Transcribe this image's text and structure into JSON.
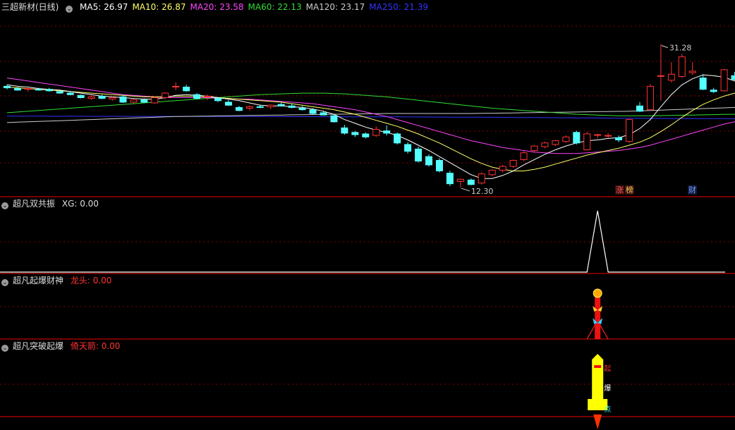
{
  "main": {
    "title": "三超新材(日线)",
    "ma": [
      {
        "label": "MA5: 26.97",
        "color": "#ffffff"
      },
      {
        "label": "MA10: 26.87",
        "color": "#ffff66"
      },
      {
        "label": "MA20: 23.58",
        "color": "#ff44ff"
      },
      {
        "label": "MA60: 22.13",
        "color": "#33dd33"
      },
      {
        "label": "MA120: 23.17",
        "color": "#cccccc"
      },
      {
        "label": "MA250: 21.39",
        "color": "#3333ff"
      }
    ],
    "high_label": "31.28",
    "low_label": "12.30",
    "tag_zhang": "涨",
    "tag_bang": "榜",
    "tag_cai": "财"
  },
  "panel1": {
    "title": "超凡双共振",
    "field": "XG: 0.00"
  },
  "panel2": {
    "title": "超凡起爆财神",
    "field_name": "龙头",
    "field_value": ": 0.00"
  },
  "panel3": {
    "title": "超凡突破起爆",
    "field_name": "倚天箭",
    "field_value": ": 0.00",
    "rocket_chars": [
      "起",
      "爆",
      "点"
    ]
  },
  "colors": {
    "up": "#ff3232",
    "down": "#54ffff",
    "grid": "#8b0000",
    "axis": "#c00000"
  },
  "chart_data": {
    "type": "candlestick",
    "ylim": [
      11,
      36
    ],
    "candles": [
      [
        25.7,
        25.9,
        25.3,
        25.5
      ],
      [
        25.4,
        25.6,
        25.1,
        25.2
      ],
      [
        25.3,
        25.5,
        25.0,
        25.4
      ],
      [
        25.3,
        25.5,
        25.1,
        25.2
      ],
      [
        25.3,
        25.5,
        25.0,
        25.1
      ],
      [
        25.0,
        25.2,
        24.7,
        24.8
      ],
      [
        24.8,
        25.1,
        24.5,
        24.6
      ],
      [
        24.5,
        24.6,
        24.1,
        24.2
      ],
      [
        24.1,
        24.5,
        23.9,
        24.3
      ],
      [
        24.4,
        24.6,
        24.0,
        24.1
      ],
      [
        24.0,
        24.3,
        23.8,
        24.2
      ],
      [
        24.3,
        24.6,
        23.5,
        23.6
      ],
      [
        23.6,
        24.0,
        23.4,
        23.9
      ],
      [
        23.9,
        24.1,
        23.5,
        23.6
      ],
      [
        23.5,
        24.3,
        23.4,
        24.2
      ],
      [
        24.2,
        24.9,
        24.0,
        24.8
      ],
      [
        25.6,
        26.2,
        25.2,
        25.7
      ],
      [
        25.6,
        25.9,
        25.0,
        25.1
      ],
      [
        24.6,
        24.8,
        24.0,
        24.1
      ],
      [
        24.3,
        24.6,
        23.9,
        24.4
      ],
      [
        24.1,
        24.3,
        23.6,
        23.8
      ],
      [
        23.6,
        23.9,
        23.1,
        23.2
      ],
      [
        22.9,
        23.1,
        22.4,
        22.5
      ],
      [
        22.8,
        23.2,
        22.5,
        23.0
      ],
      [
        23.0,
        23.3,
        22.8,
        22.9
      ],
      [
        23.0,
        23.3,
        22.7,
        23.2
      ],
      [
        23.3,
        23.6,
        23.0,
        23.1
      ],
      [
        23.1,
        23.4,
        22.8,
        22.9
      ],
      [
        22.8,
        23.1,
        22.5,
        22.6
      ],
      [
        22.6,
        22.8,
        22.0,
        22.1
      ],
      [
        22.2,
        22.5,
        21.9,
        21.9
      ],
      [
        21.8,
        22.0,
        20.9,
        21.0
      ],
      [
        20.2,
        20.6,
        19.3,
        19.5
      ],
      [
        19.6,
        19.8,
        19.0,
        19.3
      ],
      [
        19.4,
        19.6,
        18.8,
        19.0
      ],
      [
        19.2,
        20.4,
        19.0,
        20.0
      ],
      [
        19.8,
        20.5,
        19.2,
        19.5
      ],
      [
        19.4,
        19.6,
        18.0,
        18.2
      ],
      [
        18.0,
        18.3,
        16.8,
        17.1
      ],
      [
        17.4,
        17.7,
        15.6,
        15.8
      ],
      [
        16.4,
        16.7,
        15.1,
        15.3
      ],
      [
        15.9,
        16.2,
        14.3,
        14.5
      ],
      [
        14.2,
        14.5,
        12.5,
        12.8
      ],
      [
        13.1,
        13.5,
        12.3,
        13.4
      ],
      [
        13.3,
        13.5,
        12.6,
        12.7
      ],
      [
        12.9,
        14.3,
        12.7,
        14.1
      ],
      [
        14.0,
        14.7,
        13.8,
        14.6
      ],
      [
        14.6,
        15.3,
        14.3,
        15.1
      ],
      [
        15.1,
        16.0,
        14.9,
        15.9
      ],
      [
        16.0,
        17.1,
        15.8,
        16.9
      ],
      [
        17.2,
        17.9,
        16.9,
        17.8
      ],
      [
        17.7,
        18.4,
        17.5,
        18.2
      ],
      [
        18.0,
        18.6,
        17.8,
        18.5
      ],
      [
        18.4,
        19.2,
        18.2,
        19.0
      ],
      [
        19.6,
        19.8,
        18.0,
        18.2
      ],
      [
        17.3,
        19.7,
        17.2,
        19.4
      ],
      [
        19.3,
        19.4,
        18.8,
        19.3
      ],
      [
        19.1,
        19.5,
        18.9,
        19.2
      ],
      [
        18.9,
        19.2,
        18.3,
        18.6
      ],
      [
        18.4,
        21.4,
        18.2,
        21.3
      ],
      [
        23.1,
        23.6,
        22.3,
        22.4
      ],
      [
        22.6,
        26.0,
        22.5,
        25.7
      ],
      [
        27.1,
        31.3,
        23.8,
        27.1
      ],
      [
        26.5,
        28.9,
        26.2,
        27.3
      ],
      [
        27.0,
        30.0,
        26.8,
        29.6
      ],
      [
        27.5,
        28.9,
        27.2,
        27.7
      ],
      [
        26.8,
        27.3,
        25.2,
        25.3
      ],
      [
        25.2,
        25.5,
        24.8,
        25.0
      ],
      [
        25.1,
        28.0,
        25.0,
        27.9
      ],
      [
        27.1,
        27.6,
        26.5,
        26.6
      ],
      [
        27.1,
        28.6,
        26.9,
        28.5
      ],
      [
        28.5,
        28.9,
        27.3,
        27.5
      ],
      [
        28.2,
        28.5,
        27.3,
        27.4
      ],
      [
        27.3,
        27.6,
        25.6,
        25.7
      ]
    ],
    "ma5": [
      25.9,
      25.7,
      25.6,
      25.4,
      25.3,
      25.2,
      25.0,
      24.8,
      24.6,
      24.4,
      24.3,
      24.2,
      24.1,
      24.0,
      24.0,
      24.2,
      24.5,
      24.6,
      24.5,
      24.4,
      24.2,
      24.0,
      23.8,
      23.5,
      23.2,
      23.1,
      23.1,
      23.0,
      22.9,
      22.7,
      22.4,
      22.0,
      21.3,
      20.8,
      20.3,
      19.9,
      19.6,
      19.2,
      18.6,
      17.9,
      17.2,
      16.4,
      15.6,
      14.8,
      14.0,
      13.5,
      13.5,
      13.9,
      14.5,
      15.3,
      16.0,
      16.7,
      17.3,
      17.8,
      18.2,
      18.5,
      18.6,
      18.8,
      18.9,
      19.3,
      20.1,
      21.3,
      23.0,
      24.6,
      25.9,
      26.7,
      27.2,
      27.1,
      26.9,
      26.4,
      26.6,
      27.0,
      27.1,
      27.0
    ],
    "ma10": [
      25.6,
      25.5,
      25.4,
      25.3,
      25.2,
      25.1,
      25.0,
      24.9,
      24.8,
      24.7,
      24.6,
      24.5,
      24.4,
      24.3,
      24.3,
      24.3,
      24.4,
      24.4,
      24.4,
      24.3,
      24.2,
      24.1,
      24.0,
      23.9,
      23.8,
      23.7,
      23.6,
      23.4,
      23.2,
      23.0,
      22.8,
      22.6,
      22.3,
      22.0,
      21.6,
      21.2,
      20.8,
      20.4,
      19.9,
      19.4,
      18.8,
      18.2,
      17.5,
      16.8,
      16.1,
      15.5,
      15.0,
      14.7,
      14.5,
      14.5,
      14.7,
      15.0,
      15.4,
      15.8,
      16.2,
      16.6,
      16.9,
      17.2,
      17.5,
      17.9,
      18.3,
      18.9,
      19.7,
      20.6,
      21.6,
      22.5,
      23.3,
      23.9,
      24.4,
      24.8,
      25.4,
      26.0,
      26.4,
      26.9
    ],
    "ma20": [
      26.8,
      26.6,
      26.4,
      26.2,
      26.0,
      25.8,
      25.6,
      25.4,
      25.2,
      25.0,
      24.8,
      24.6,
      24.5,
      24.4,
      24.3,
      24.2,
      24.2,
      24.2,
      24.2,
      24.2,
      24.1,
      24.1,
      24.0,
      24.0,
      23.9,
      23.8,
      23.7,
      23.6,
      23.5,
      23.4,
      23.2,
      23.0,
      22.8,
      22.6,
      22.3,
      22.0,
      21.7,
      21.3,
      20.9,
      20.5,
      20.1,
      19.7,
      19.3,
      18.9,
      18.5,
      18.2,
      17.9,
      17.6,
      17.4,
      17.2,
      17.0,
      16.9,
      16.8,
      16.8,
      16.8,
      16.9,
      17.0,
      17.1,
      17.2,
      17.4,
      17.6,
      17.9,
      18.3,
      18.7,
      19.1,
      19.5,
      19.9,
      20.3,
      20.7,
      21.0,
      21.5,
      22.0,
      22.5,
      23.0
    ],
    "ma60": [
      22.2,
      22.3,
      22.4,
      22.5,
      22.6,
      22.7,
      22.8,
      22.9,
      23.0,
      23.1,
      23.2,
      23.3,
      23.4,
      23.5,
      23.6,
      23.7,
      23.8,
      23.9,
      24.0,
      24.1,
      24.2,
      24.3,
      24.4,
      24.5,
      24.6,
      24.65,
      24.7,
      24.75,
      24.8,
      24.8,
      24.8,
      24.75,
      24.7,
      24.6,
      24.5,
      24.4,
      24.3,
      24.15,
      24.0,
      23.85,
      23.7,
      23.55,
      23.4,
      23.25,
      23.1,
      22.95,
      22.8,
      22.7,
      22.6,
      22.5,
      22.4,
      22.3,
      22.2,
      22.1,
      22.0,
      21.95,
      21.9,
      21.85,
      21.8,
      21.8,
      21.8,
      21.8,
      21.82,
      21.85,
      21.88,
      21.9,
      21.92,
      21.95,
      21.98,
      22.0,
      22.03,
      22.06,
      22.1,
      22.13
    ],
    "ma120": [
      20.9,
      20.95,
      21.0,
      21.05,
      21.1,
      21.15,
      21.2,
      21.25,
      21.3,
      21.35,
      21.4,
      21.45,
      21.5,
      21.55,
      21.6,
      21.65,
      21.7,
      21.72,
      21.74,
      21.76,
      21.78,
      21.8,
      21.82,
      21.84,
      21.86,
      21.88,
      21.9,
      21.92,
      21.94,
      21.96,
      21.98,
      22.0,
      22.02,
      22.04,
      22.06,
      22.08,
      22.1,
      22.1,
      22.1,
      22.1,
      22.1,
      22.1,
      22.1,
      22.1,
      22.1,
      22.12,
      22.14,
      22.16,
      22.18,
      22.2,
      22.22,
      22.24,
      22.26,
      22.28,
      22.3,
      22.32,
      22.34,
      22.36,
      22.38,
      22.4,
      22.45,
      22.5,
      22.55,
      22.6,
      22.65,
      22.7,
      22.75,
      22.8,
      22.85,
      22.9,
      22.95,
      23.0,
      23.08,
      23.17
    ],
    "ma250": [
      21.75,
      21.75,
      21.75,
      21.75,
      21.74,
      21.74,
      21.74,
      21.74,
      21.73,
      21.73,
      21.73,
      21.73,
      21.72,
      21.72,
      21.72,
      21.72,
      21.71,
      21.71,
      21.71,
      21.71,
      21.7,
      21.7,
      21.7,
      21.7,
      21.69,
      21.69,
      21.69,
      21.68,
      21.68,
      21.68,
      21.67,
      21.67,
      21.67,
      21.66,
      21.66,
      21.66,
      21.65,
      21.65,
      21.64,
      21.64,
      21.63,
      21.63,
      21.62,
      21.62,
      21.61,
      21.61,
      21.6,
      21.59,
      21.58,
      21.57,
      21.56,
      21.55,
      21.54,
      21.53,
      21.52,
      21.51,
      21.5,
      21.49,
      21.48,
      21.47,
      21.46,
      21.45,
      21.45,
      21.44,
      21.44,
      21.43,
      21.43,
      21.42,
      21.42,
      21.41,
      21.41,
      21.4,
      21.4,
      21.39
    ],
    "signal_index": 56
  }
}
